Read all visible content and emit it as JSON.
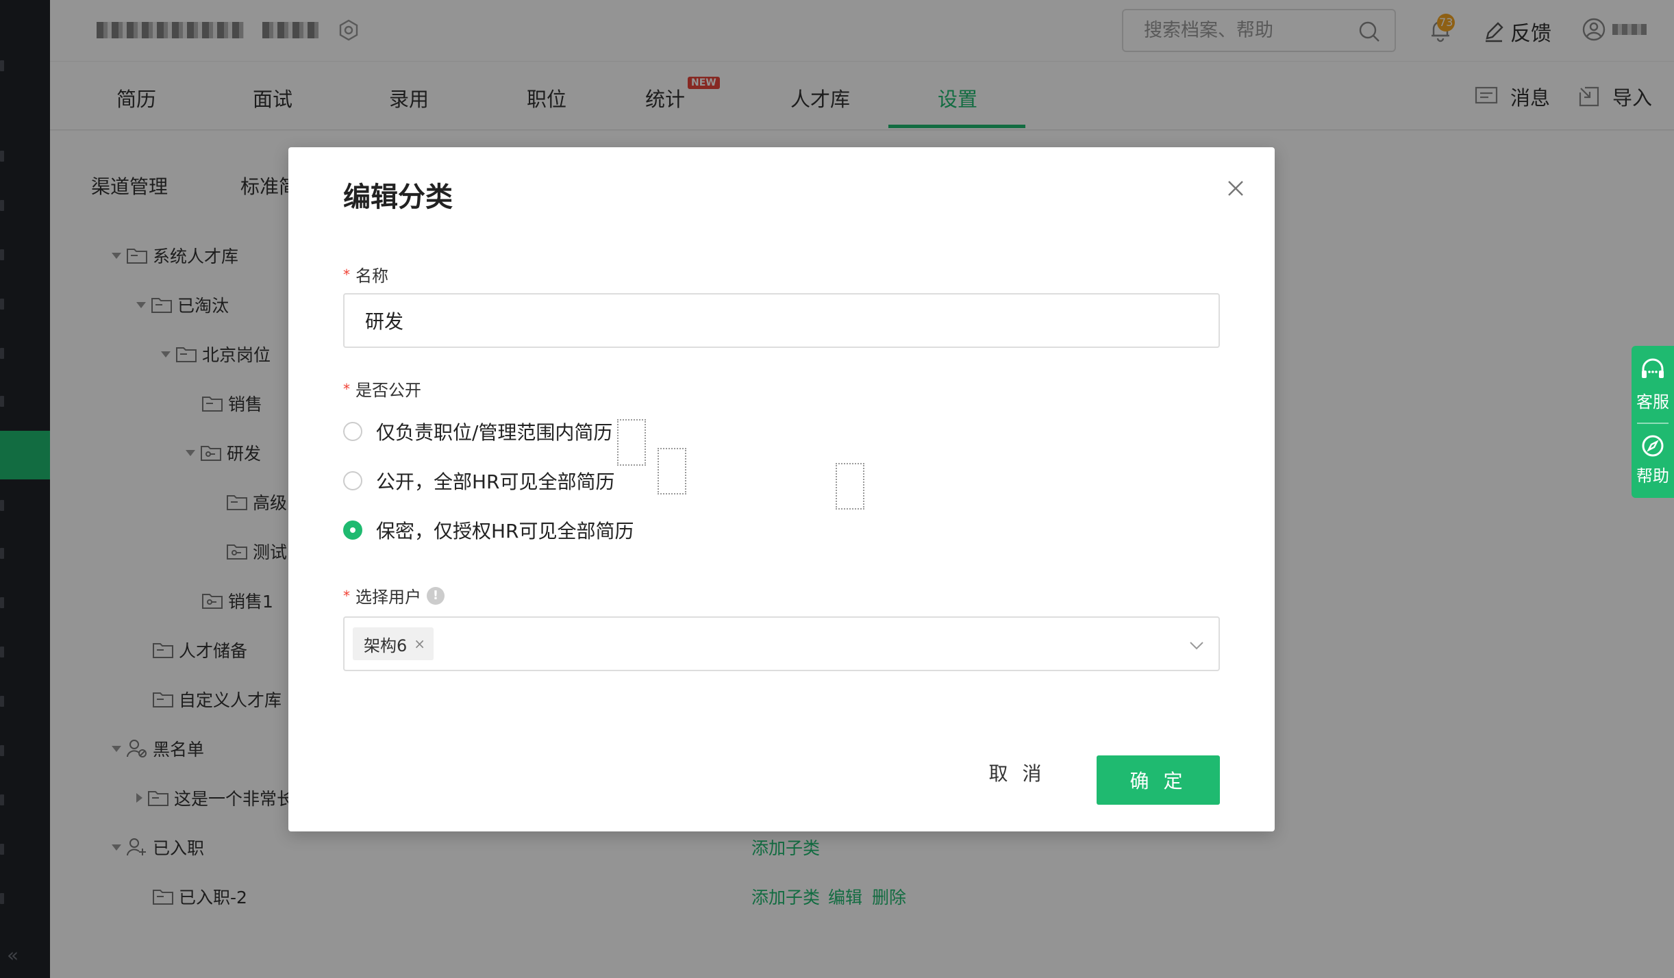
{
  "header": {
    "search_placeholder": "搜索档案、帮助",
    "notification_count": "73",
    "feedback_label": "反馈"
  },
  "nav": {
    "items": [
      "简历",
      "面试",
      "录用",
      "职位",
      "统计",
      "人才库",
      "设置"
    ],
    "active": "设置",
    "new_badge": "NEW",
    "messages_label": "消息",
    "import_label": "导入"
  },
  "subtabs": [
    "渠道管理",
    "标准简"
  ],
  "tree": [
    {
      "label": "系统人才库"
    },
    {
      "label": "已淘汰"
    },
    {
      "label": "北京岗位"
    },
    {
      "label": "销售"
    },
    {
      "label": "研发"
    },
    {
      "label": "高级"
    },
    {
      "label": "测试"
    },
    {
      "label": "销售1"
    },
    {
      "label": "人才储备"
    },
    {
      "label": "自定义人才库"
    },
    {
      "label": "黑名单"
    },
    {
      "label": "这是一个非常长"
    },
    {
      "label": "已入职"
    },
    {
      "label": "已入职-2"
    }
  ],
  "actions": {
    "add_child": "添加子类",
    "edit": "编辑",
    "delete": "删除"
  },
  "float": {
    "service_label": "客服",
    "help_label": "帮助"
  },
  "modal": {
    "title": "编辑分类",
    "name_label": "名称",
    "name_value": "研发",
    "public_label": "是否公开",
    "options": [
      "仅负责职位/管理范围内简历",
      "公开，全部HR可见全部简历",
      "保密，仅授权HR可见全部简历"
    ],
    "selected_option_index": 2,
    "users_label": "选择用户",
    "selected_users": [
      "架构6"
    ],
    "cancel_label": "取 消",
    "ok_label": "确 定"
  },
  "colors": {
    "accent": "#1fba70",
    "sidebar": "#1f2329",
    "new_badge": "#e8453c",
    "notify_badge": "#f5a623",
    "required": "#f04134"
  }
}
